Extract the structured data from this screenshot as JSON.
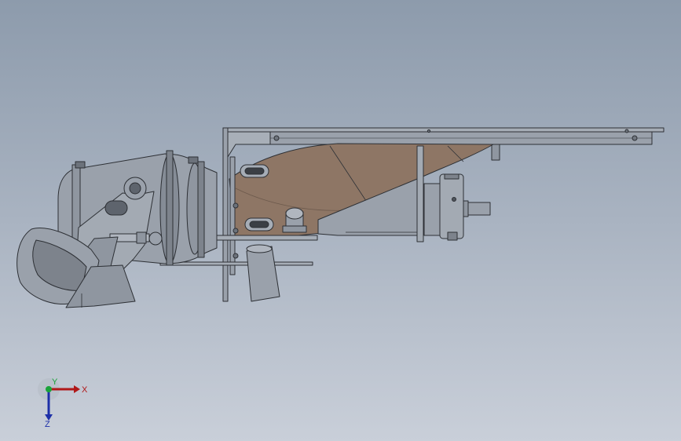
{
  "viewport": {
    "background_top": "#8d9bac",
    "background_bottom": "#c9cfd9"
  },
  "model": {
    "part_gray": "#9aa1ab",
    "part_dark": "#5e646d",
    "duct_color": "#8e7665",
    "outline": "#2d3035"
  },
  "triad": {
    "x_label": "X",
    "y_label": "Y",
    "z_label": "Z",
    "x_color": "#b01818",
    "y_color": "#1aa33a",
    "z_color": "#1d2fa8"
  }
}
